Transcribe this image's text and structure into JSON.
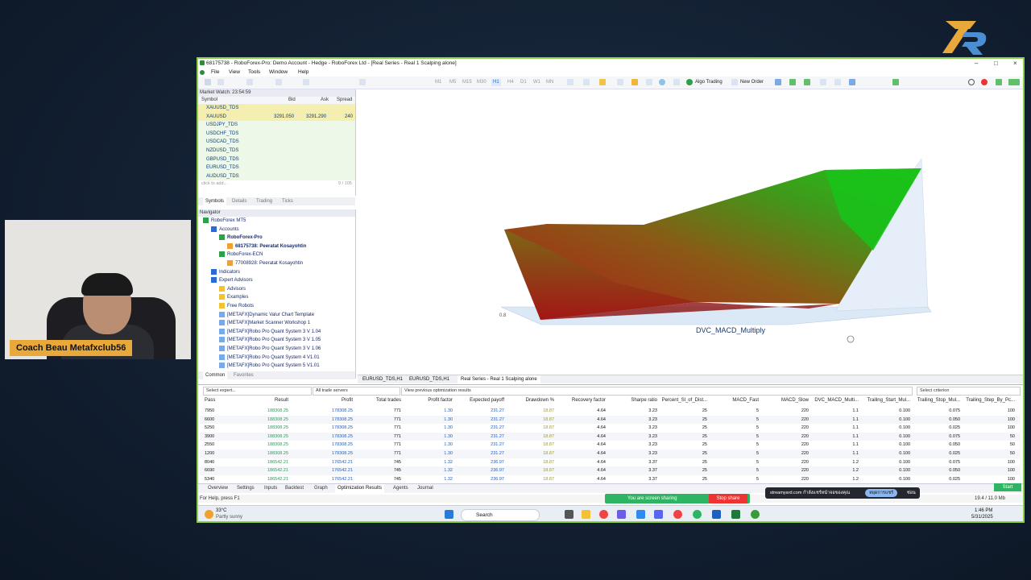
{
  "webcam": {
    "label": "Coach Beau Metafxclub56"
  },
  "window": {
    "title": "68175738 - RoboForex-Pro: Demo Account - Hedge - RoboForex Ltd - [Real Series - Real 1 Scalping  alone]",
    "menu": [
      "File",
      "View",
      "Tools",
      "Window",
      "Help"
    ],
    "toolbar": {
      "algo_trading": "Algo Trading",
      "new_order": "New Order",
      "timeframes": [
        "M1",
        "M5",
        "M15",
        "M30",
        "H1",
        "H4",
        "D1",
        "W1",
        "MN"
      ]
    }
  },
  "market_watch": {
    "title": "Market Watch: 23:54:59",
    "columns": [
      "Symbol",
      "Bid",
      "Ask",
      "Spread"
    ],
    "rows": [
      {
        "symbol": "XAUUSD_TDS",
        "bid": "",
        "ask": "",
        "spread": ""
      },
      {
        "symbol": "XAUUSD",
        "bid": "3291.050",
        "ask": "3291.290",
        "spread": "240"
      },
      {
        "symbol": "USDJPY_TDS",
        "bid": "",
        "ask": "",
        "spread": ""
      },
      {
        "symbol": "USDCHF_TDS",
        "bid": "",
        "ask": "",
        "spread": ""
      },
      {
        "symbol": "USDCAD_TDS",
        "bid": "",
        "ask": "",
        "spread": ""
      },
      {
        "symbol": "NZDUSD_TDS",
        "bid": "",
        "ask": "",
        "spread": ""
      },
      {
        "symbol": "GBPUSD_TDS",
        "bid": "",
        "ask": "",
        "spread": ""
      },
      {
        "symbol": "EURUSD_TDS",
        "bid": "",
        "ask": "",
        "spread": ""
      },
      {
        "symbol": "AUDUSD_TDS",
        "bid": "",
        "ask": "",
        "spread": ""
      }
    ],
    "add_hint": "click to add...",
    "count": "9 / 105",
    "tabs": [
      "Symbols",
      "Details",
      "Trading",
      "Ticks"
    ]
  },
  "navigator": {
    "title": "Navigator",
    "items": [
      {
        "label": "RoboForex MT5",
        "indent": 0
      },
      {
        "label": "Accounts",
        "indent": 1
      },
      {
        "label": "RoboForex-Pro",
        "indent": 2
      },
      {
        "label": "68175738: Peeratat Kosayohtin",
        "indent": 3
      },
      {
        "label": "RoboForex-ECN",
        "indent": 2
      },
      {
        "label": "77008928: Peeratat Kosayohtin",
        "indent": 3
      },
      {
        "label": "Indicators",
        "indent": 1
      },
      {
        "label": "Expert Advisors",
        "indent": 1
      },
      {
        "label": "Advisors",
        "indent": 2
      },
      {
        "label": "Examples",
        "indent": 2
      },
      {
        "label": "Free Robots",
        "indent": 2
      },
      {
        "label": "[METAFX]Dynamic Valur Chart Template",
        "indent": 2
      },
      {
        "label": "[METAFX]Market Scanner Workshop 1",
        "indent": 2
      },
      {
        "label": "[METAFX]Robo Pro Quant System 3 V 1.04",
        "indent": 2
      },
      {
        "label": "[METAFX]Robo Pro Quant System 3 V 1.05",
        "indent": 2
      },
      {
        "label": "[METAFX]Robo Pro Quant System 3 V 1.06",
        "indent": 2
      },
      {
        "label": "[METAFX]Robo Pro Quant System 4 V1.01",
        "indent": 2
      },
      {
        "label": "[METAFX]Robo Pro Quant System 5 V1.01",
        "indent": 2
      }
    ],
    "tabs": [
      "Common",
      "Favorites"
    ]
  },
  "chart": {
    "axis_label": "DVC_MACD_Multiply",
    "corner_label_left": "0.8",
    "tabs": [
      "EURUSD_TDS,H1",
      "EURUSD_TDS,H1",
      "Real Series - Real 1 Scalping  alone"
    ]
  },
  "tester": {
    "filters": {
      "expert": "Select expert...",
      "servers": "All trade servers",
      "previous": "View previous optimization results",
      "criterion": "Select criterion"
    },
    "columns": [
      "Pass",
      "Result",
      "Profit",
      "Total trades",
      "Profit factor",
      "Expected payoff",
      "Drawdown %",
      "Recovery factor",
      "Sharpe ratio",
      "Percent_Sl_of_Dist...",
      "MACD_Fast",
      "MACD_Slow",
      "DVC_MACD_Multi...",
      "Trailing_Start_Mul...",
      "Trailing_Stop_Mul...",
      "Trailing_Step_By_Pc..."
    ],
    "rows": [
      [
        "7950",
        "188308.25",
        "178308.25",
        "771",
        "1.30",
        "231.27",
        "18.87",
        "4.64",
        "3.23",
        "25",
        "5",
        "220",
        "1.1",
        "0.100",
        "0.075",
        "100"
      ],
      [
        "6600",
        "188308.25",
        "178308.25",
        "771",
        "1.30",
        "231.27",
        "18.87",
        "4.64",
        "3.23",
        "25",
        "5",
        "220",
        "1.1",
        "0.100",
        "0.050",
        "100"
      ],
      [
        "5250",
        "188308.25",
        "178308.25",
        "771",
        "1.30",
        "231.27",
        "18.87",
        "4.64",
        "3.23",
        "25",
        "5",
        "220",
        "1.1",
        "0.100",
        "0.025",
        "100"
      ],
      [
        "3900",
        "188308.25",
        "178308.25",
        "771",
        "1.30",
        "231.27",
        "18.87",
        "4.64",
        "3.23",
        "25",
        "5",
        "220",
        "1.1",
        "0.100",
        "0.075",
        "50"
      ],
      [
        "2550",
        "188308.25",
        "178308.25",
        "771",
        "1.30",
        "231.27",
        "18.87",
        "4.64",
        "3.23",
        "25",
        "5",
        "220",
        "1.1",
        "0.100",
        "0.050",
        "50"
      ],
      [
        "1200",
        "188308.25",
        "178308.25",
        "771",
        "1.30",
        "231.27",
        "18.87",
        "4.64",
        "3.23",
        "25",
        "5",
        "220",
        "1.1",
        "0.100",
        "0.025",
        "50"
      ],
      [
        "8040",
        "186542.21",
        "176542.21",
        "745",
        "1.32",
        "236.97",
        "18.87",
        "4.64",
        "3.37",
        "25",
        "5",
        "220",
        "1.2",
        "0.100",
        "0.075",
        "100"
      ],
      [
        "6690",
        "186542.21",
        "176542.21",
        "745",
        "1.32",
        "236.97",
        "18.87",
        "4.64",
        "3.37",
        "25",
        "5",
        "220",
        "1.2",
        "0.100",
        "0.050",
        "100"
      ],
      [
        "5340",
        "186542.21",
        "176542.21",
        "745",
        "1.32",
        "236.97",
        "18.87",
        "4.64",
        "3.37",
        "25",
        "5",
        "220",
        "1.2",
        "0.100",
        "0.025",
        "100"
      ]
    ],
    "tabs": [
      "Overview",
      "Settings",
      "Inputs",
      "Backtest",
      "Graph",
      "Optimization Results",
      "Agents",
      "Journal"
    ],
    "side_label": "Strategy Tester",
    "start": "Start"
  },
  "status": {
    "help": "For Help, press F1",
    "traffic": "19.4 / 11.0 Mb"
  },
  "share": {
    "text": "You are screen sharing",
    "stop": "Stop share",
    "streamyard": "streamyard.com กำลังแชร์หน้าจอของคุณ",
    "hide": "ซ่อน",
    "stop_th": "หยุดการแชร์"
  },
  "taskbar": {
    "weather_temp": "33°C",
    "weather": "Partly sunny",
    "search": "Search",
    "time": "1:46 PM",
    "date": "5/31/2025"
  },
  "colors": {
    "accent_green": "#8bd04a",
    "profit_blue": "#1f5fbf",
    "drawdown_olive": "#9a9a33",
    "result_green": "#2c9c5a"
  }
}
